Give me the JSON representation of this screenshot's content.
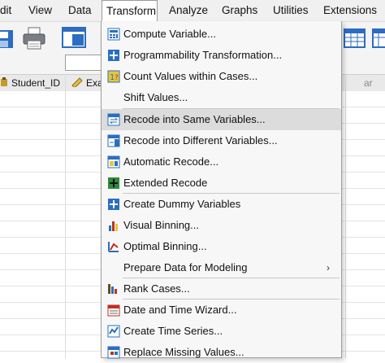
{
  "menubar": {
    "items": [
      {
        "label": "dit"
      },
      {
        "label": "View"
      },
      {
        "label": "Data"
      },
      {
        "label": "Transform"
      },
      {
        "label": "Analyze"
      },
      {
        "label": "Graphs"
      },
      {
        "label": "Utilities"
      },
      {
        "label": "Extensions"
      }
    ]
  },
  "grid": {
    "columns": [
      {
        "label": "Student_ID",
        "icon": "ruler-icon"
      },
      {
        "label": "Exa",
        "icon": "ruler-icon"
      },
      {
        "label": "ar"
      }
    ]
  },
  "transform_menu": {
    "items": [
      {
        "label": "Compute Variable...",
        "icon": "calculator-icon"
      },
      {
        "label": "Programmability Transformation...",
        "icon": "plus-box-icon"
      },
      {
        "label": "Count Values within Cases...",
        "icon": "count-icon"
      },
      {
        "label": "Shift Values...",
        "icon": ""
      },
      {
        "label": "Recode into Same Variables...",
        "icon": "recode-same-icon",
        "highlighted": true
      },
      {
        "label": "Recode into Different Variables...",
        "icon": "recode-different-icon"
      },
      {
        "label": "Automatic Recode...",
        "icon": "automatic-recode-icon"
      },
      {
        "label": "Extended Recode",
        "icon": "extended-recode-icon"
      },
      {
        "label": "Create Dummy Variables",
        "icon": "plus-box-icon"
      },
      {
        "label": "Visual Binning...",
        "icon": "visual-binning-icon"
      },
      {
        "label": "Optimal Binning...",
        "icon": "optimal-binning-icon"
      },
      {
        "label": "Prepare Data for Modeling",
        "icon": "",
        "submenu": true,
        "arrow": "›"
      },
      {
        "label": "Rank Cases...",
        "icon": "rank-cases-icon"
      },
      {
        "label": "Date and Time Wizard...",
        "icon": "calendar-icon"
      },
      {
        "label": "Create Time Series...",
        "icon": "time-series-icon"
      },
      {
        "label": "Replace Missing Values...",
        "icon": "replace-missing-icon"
      }
    ]
  },
  "colors": {
    "menubar_bg": "#f0f0f0",
    "dropdown_bg": "#f7f7f7",
    "highlight": "#dcdcdc",
    "icon_blue": "#2a6fbf",
    "icon_green": "#2e8b3a"
  }
}
